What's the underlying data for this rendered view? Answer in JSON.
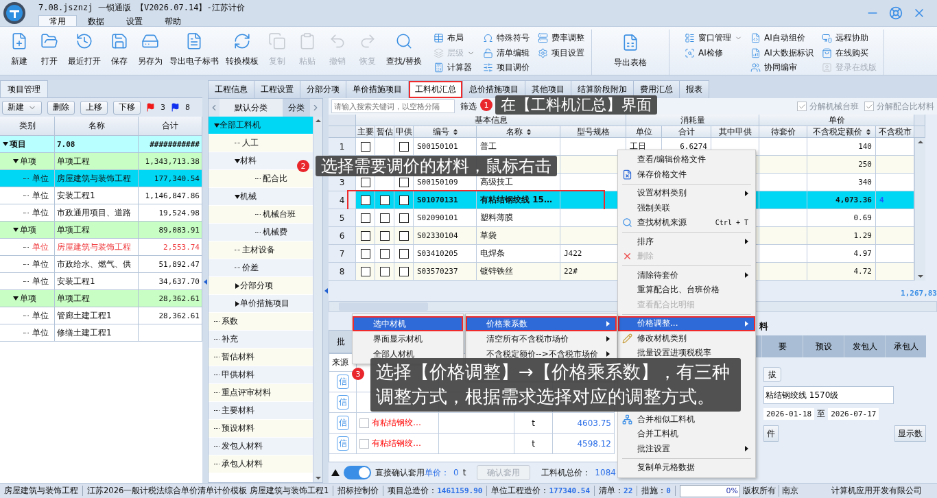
{
  "window": {
    "title": "7.08.jsznzj 一锁通版 【V2026.07.14】-江苏计价"
  },
  "menu_tabs": [
    {
      "label": "常用",
      "selected": true
    },
    {
      "label": "数据",
      "selected": false
    },
    {
      "label": "设置",
      "selected": false
    },
    {
      "label": "帮助",
      "selected": false
    }
  ],
  "ribbon": {
    "sections": [
      {
        "big": [
          {
            "label": "新建",
            "disabled": false
          },
          {
            "label": "打开",
            "disabled": false
          },
          {
            "label": "最近打开",
            "disabled": false
          },
          {
            "label": "保存",
            "disabled": false
          },
          {
            "label": "另存为",
            "disabled": false
          },
          {
            "label": "导出电子标书",
            "disabled": false
          },
          {
            "label": "转换模板",
            "disabled": false
          },
          {
            "label": "复制",
            "disabled": true
          },
          {
            "label": "粘贴",
            "disabled": true
          },
          {
            "label": "撤销",
            "disabled": true
          },
          {
            "label": "恢复",
            "disabled": true
          },
          {
            "label": "查找/替换",
            "disabled": false
          }
        ],
        "columns": [
          [
            {
              "label": "布局",
              "disabled": false,
              "dropdown": false
            },
            {
              "label": "层级",
              "disabled": true,
              "dropdown": true
            },
            {
              "label": "计算器",
              "disabled": false,
              "dropdown": false
            }
          ],
          [
            {
              "label": "特殊符号",
              "disabled": false,
              "dropdown": false
            },
            {
              "label": "清单编辑",
              "disabled": false,
              "dropdown": false
            },
            {
              "label": "项目调价",
              "disabled": false,
              "dropdown": false
            }
          ],
          [
            {
              "label": "费率调整",
              "disabled": false,
              "dropdown": false
            },
            {
              "label": "项目设置",
              "disabled": false,
              "dropdown": false
            }
          ]
        ]
      },
      {
        "big": [
          {
            "label": "导出表格",
            "disabled": false
          }
        ]
      },
      {
        "columns": [
          [
            {
              "label": "窗口管理",
              "disabled": false,
              "dropdown": true
            },
            {
              "label": "AI检修",
              "disabled": false,
              "dropdown": false
            }
          ],
          [
            {
              "label": "AI自动组价",
              "disabled": false,
              "dropdown": false
            },
            {
              "label": "AI大数据标识",
              "disabled": false,
              "dropdown": false
            },
            {
              "label": "协同编审",
              "disabled": false,
              "dropdown": false
            }
          ],
          [
            {
              "label": "远程协助",
              "disabled": false,
              "dropdown": false
            },
            {
              "label": "在线购买",
              "disabled": false,
              "dropdown": false
            },
            {
              "label": "登录在线版",
              "disabled": true,
              "dropdown": false
            }
          ]
        ]
      }
    ]
  },
  "project": {
    "tab": "项目管理",
    "toolbar": [
      {
        "label": "新建",
        "dropdown": true
      },
      {
        "label": "删除",
        "dropdown": false
      },
      {
        "label": "上移",
        "dropdown": false
      },
      {
        "label": "下移",
        "dropdown": false
      }
    ],
    "red_flags": "3",
    "blue_flags": "8",
    "columns": [
      "类别",
      "名称",
      "合计"
    ],
    "tree": [
      {
        "kind": "project",
        "type": "项目",
        "name": "7.08",
        "total": "###########",
        "expanded": true,
        "selected": false,
        "flagged": false,
        "children": [
          {
            "kind": "item",
            "type": "单项",
            "name": "单项工程",
            "total": "1,343,713.38",
            "expanded": true,
            "selected": false,
            "flagged": false,
            "children": [
              {
                "kind": "unit",
                "type": "单位",
                "name": "房屋建筑与装饰工程",
                "total": "177,340.54",
                "selected": true,
                "flagged": false
              },
              {
                "kind": "unit",
                "type": "单位",
                "name": "安装工程1",
                "total": "1,146,847.86",
                "selected": false,
                "flagged": false
              },
              {
                "kind": "unit",
                "type": "单位",
                "name": "市政通用项目、道路",
                "total": "19,524.98",
                "selected": false,
                "flagged": false
              }
            ]
          },
          {
            "kind": "item",
            "type": "单项",
            "name": "单项工程",
            "total": "89,083.91",
            "expanded": true,
            "selected": false,
            "flagged": false,
            "children": [
              {
                "kind": "unit",
                "type": "单位",
                "name": "房屋建筑与装饰工程",
                "total": "2,553.74",
                "selected": false,
                "flagged": true
              },
              {
                "kind": "unit",
                "type": "单位",
                "name": "市政给水、燃气、供",
                "total": "51,892.47",
                "selected": false,
                "flagged": false
              },
              {
                "kind": "unit",
                "type": "单位",
                "name": "安装工程1",
                "total": "34,637.70",
                "selected": false,
                "flagged": false
              }
            ]
          },
          {
            "kind": "item",
            "type": "单项",
            "name": "单项工程",
            "total": "28,362.61",
            "expanded": true,
            "selected": false,
            "flagged": false,
            "children": [
              {
                "kind": "unit",
                "type": "单位",
                "name": "管廊土建工程1",
                "total": "28,362.61",
                "selected": false,
                "flagged": false
              },
              {
                "kind": "unit",
                "type": "单位",
                "name": "修缮土建工程1",
                "selected": false,
                "flagged": false
              }
            ]
          }
        ]
      }
    ]
  },
  "main_tabs": [
    {
      "label": "工程信息",
      "selected": false,
      "framed": false
    },
    {
      "label": "工程设置",
      "selected": false,
      "framed": false
    },
    {
      "label": "分部分项",
      "selected": false,
      "framed": false
    },
    {
      "label": "单价措施项目",
      "selected": false,
      "framed": false
    },
    {
      "label": "工料机汇总",
      "selected": true,
      "framed": true
    },
    {
      "label": "总价措施项目",
      "selected": false,
      "framed": false
    },
    {
      "label": "其他项目",
      "selected": false,
      "framed": false
    },
    {
      "label": "结算阶段附加",
      "selected": false,
      "framed": false
    },
    {
      "label": "费用汇总",
      "selected": false,
      "framed": false
    },
    {
      "label": "报表",
      "selected": false,
      "framed": false
    }
  ],
  "categories": {
    "tabs": [
      {
        "label": "默认分类",
        "selected": true
      },
      {
        "label": "分类",
        "selected": false
      }
    ],
    "tree": [
      {
        "name": "全部工料机",
        "expanded": true,
        "selected": true,
        "children": [
          {
            "name": "人工",
            "selected": false
          },
          {
            "name": "材料",
            "expanded": true,
            "selected": false,
            "children": [
              {
                "name": "配合比",
                "selected": false
              }
            ]
          },
          {
            "name": "机械",
            "expanded": true,
            "selected": false,
            "children": [
              {
                "name": "机械台班",
                "selected": false
              },
              {
                "name": "机械费",
                "selected": false
              }
            ]
          },
          {
            "name": "主材设备",
            "selected": false
          },
          {
            "name": "价差",
            "selected": false
          },
          {
            "name": "分部分项",
            "expanded": false,
            "selected": false
          },
          {
            "name": "单价措施项目",
            "expanded": false,
            "selected": false
          }
        ]
      },
      {
        "name": "系数",
        "selected": false
      },
      {
        "name": "补充",
        "selected": false
      },
      {
        "name": "暂估材料",
        "selected": false
      },
      {
        "name": "甲供材料",
        "selected": false
      },
      {
        "name": "重点评审材料",
        "selected": false
      },
      {
        "name": "主要材料",
        "selected": false
      },
      {
        "name": "预设材料",
        "selected": false
      },
      {
        "name": "发包人材料",
        "selected": false
      },
      {
        "name": "承包人材料",
        "selected": false
      }
    ]
  },
  "grid": {
    "search": {
      "placeholder": "请输入搜索关键词，以空格分隔"
    },
    "filter": "筛选",
    "options": [
      {
        "label": "分解机械台班",
        "checked": true
      },
      {
        "label": "分解配合比材料",
        "checked": true
      }
    ],
    "groups": [
      "基本信息",
      "消耗量",
      "单价"
    ],
    "columns": [
      {
        "label": "主要",
        "sortable": false
      },
      {
        "label": "暂估",
        "sortable": false
      },
      {
        "label": "甲供",
        "sortable": false
      },
      {
        "label": "编号",
        "sortable": true
      },
      {
        "label": "名称",
        "sortable": true
      },
      {
        "label": "型号规格",
        "sortable": false
      },
      {
        "label": "单位",
        "sortable": false
      },
      {
        "label": "合计",
        "sortable": false
      },
      {
        "label": "其中甲供",
        "sortable": false
      },
      {
        "label": "待套价",
        "sortable": false
      },
      {
        "label": "不含税定额价",
        "sortable": true
      },
      {
        "label": "不含税市",
        "sortable": false
      }
    ],
    "rows": [
      {
        "no": "1",
        "main": false,
        "supply": false,
        "code": "S00150101",
        "name": "普工",
        "unit": "工日",
        "total": "6.6274",
        "price": "140",
        "selected": false,
        "framed": false
      },
      {
        "price": "250",
        "selected": false,
        "framed": false
      },
      {
        "no": "3",
        "main": false,
        "supply": false,
        "code": "S00150109",
        "name": "高级技工",
        "price": "340",
        "selected": false,
        "framed": false
      },
      {
        "no": "4",
        "main": false,
        "est": false,
        "supply": false,
        "code": "S01070131",
        "name": "有粘结钢绞线 15…",
        "price": "4,073.36",
        "price2": "4",
        "selected": true,
        "framed": true
      },
      {
        "no": "5",
        "main": false,
        "est": false,
        "supply": false,
        "code": "S02090101",
        "name": "塑料薄膜",
        "price": "0.69",
        "selected": false,
        "framed": false
      },
      {
        "no": "6",
        "main": false,
        "est": false,
        "supply": false,
        "code": "S02330104",
        "name": "草袋",
        "price": "1.29",
        "selected": false,
        "framed": false
      },
      {
        "no": "7",
        "main": false,
        "est": false,
        "supply": false,
        "code": "S03410205",
        "name": "电焊条",
        "spec": "J422",
        "price": "4.97",
        "selected": false,
        "framed": false
      },
      {
        "no": "8",
        "main": false,
        "est": false,
        "supply": false,
        "code": "S03570237",
        "name": "镀锌铁丝",
        "spec": "22#",
        "price": "4.72",
        "selected": false,
        "framed": false
      }
    ],
    "total": "1,267,83"
  },
  "lower": {
    "tab": "批",
    "source_header": "来源",
    "rows": [
      {
        "source": "信"
      },
      {
        "source": "信"
      },
      {
        "source": "信",
        "checked": false,
        "name": "有粘结钢绞…",
        "unit": "t",
        "price": "4603.75"
      },
      {
        "source": "信",
        "checked": false,
        "name": "有粘结钢绞…",
        "unit": "t",
        "price": "4598.12"
      }
    ],
    "side": {
      "title": "料",
      "tabs": [
        "要",
        "预设",
        "发包人",
        "承包人"
      ],
      "button": "拔",
      "field": "粘结钢绞线 1570级",
      "date_from": "2026-01-18",
      "date_sep": "至",
      "date_to": "2026-07-17",
      "columns": [
        "件",
        "显示数"
      ]
    }
  },
  "bottom_bar": {
    "toggle_on": true,
    "label": "直接确认套用",
    "price_label": "单价：",
    "qty": "0",
    "unit": "t",
    "confirm": {
      "label": "确认套用",
      "disabled": true
    },
    "total_label": "工料机总价：",
    "total": "1084"
  },
  "status": [
    {
      "label": "房屋建筑与装饰工程"
    },
    {
      "label": "江苏2026一般计税法综合单价清单计价模板 房屋建筑与装饰工程1"
    },
    {
      "label": "招标控制价"
    },
    {
      "label": "项目总造价：",
      "value": "1461159.90"
    },
    {
      "label": "单位工程造价：",
      "value": "177340.54"
    },
    {
      "label": "清单：",
      "value": "22"
    },
    {
      "label": "措施：",
      "value": "0"
    }
  ],
  "progress": {
    "label": "0%",
    "level": 0
  },
  "copyright": "版权所有",
  "company": [
    "南京",
    "计算机应用开发有限公司"
  ],
  "context_menu": [
    {
      "kind": "item",
      "label": "查看/编辑价格文件",
      "submenu": false,
      "disabled": false,
      "highlighted": false,
      "framed": false
    },
    {
      "kind": "item",
      "label": "保存价格文件",
      "submenu": false,
      "disabled": false,
      "highlighted": false,
      "framed": false
    },
    {
      "kind": "separator"
    },
    {
      "kind": "item",
      "label": "设置材料类别",
      "submenu": true,
      "disabled": false,
      "highlighted": false,
      "framed": false
    },
    {
      "kind": "item",
      "label": "强制关联",
      "submenu": false,
      "disabled": false,
      "highlighted": false,
      "framed": false
    },
    {
      "kind": "item",
      "label": "查找材机来源",
      "shortcut": "Ctrl + T",
      "submenu": false,
      "disabled": false,
      "highlighted": false,
      "framed": false
    },
    {
      "kind": "separator"
    },
    {
      "kind": "item",
      "label": "排序",
      "submenu": true,
      "disabled": false,
      "highlighted": false,
      "framed": false
    },
    {
      "kind": "item",
      "label": "删除",
      "submenu": false,
      "disabled": true,
      "highlighted": false,
      "framed": false
    },
    {
      "kind": "separator"
    },
    {
      "kind": "item",
      "label": "清除待套价",
      "submenu": true,
      "disabled": false,
      "highlighted": false,
      "framed": false
    },
    {
      "kind": "item",
      "label": "重算配合比、台班价格",
      "submenu": false,
      "disabled": false,
      "highlighted": false,
      "framed": false
    },
    {
      "kind": "item",
      "label": "查看配合比明细",
      "submenu": false,
      "disabled": true,
      "highlighted": false,
      "framed": false
    },
    {
      "kind": "separator"
    },
    {
      "kind": "item",
      "label": "价格调整...",
      "submenu": true,
      "disabled": false,
      "highlighted": true,
      "framed": true
    },
    {
      "kind": "item",
      "label": "修改材机类别",
      "submenu": false,
      "disabled": false,
      "highlighted": false,
      "framed": false
    },
    {
      "kind": "item",
      "label": "批量设置进项税税率",
      "submenu": false,
      "disabled": false,
      "highlighted": false,
      "framed": false
    },
    {
      "kind": "covered"
    },
    {
      "kind": "covered"
    },
    {
      "kind": "covered"
    },
    {
      "kind": "item",
      "label": "合并相似工料机",
      "submenu": false,
      "disabled": false,
      "highlighted": false,
      "framed": false
    },
    {
      "kind": "item",
      "label": "合并工料机",
      "submenu": false,
      "disabled": false,
      "highlighted": false,
      "framed": false
    },
    {
      "kind": "item",
      "label": "批注设置",
      "submenu": true,
      "disabled": false,
      "highlighted": false,
      "framed": false
    },
    {
      "kind": "separator"
    },
    {
      "kind": "item",
      "label": "复制单元格数据",
      "submenu": false,
      "disabled": false,
      "highlighted": false,
      "framed": false
    }
  ],
  "price_menu": [
    {
      "kind": "item",
      "label": "价格乘系数",
      "submenu": true,
      "highlighted": true,
      "framed": true
    },
    {
      "kind": "item",
      "label": "清空所有不含税市场价",
      "submenu": true,
      "highlighted": false,
      "framed": false
    },
    {
      "kind": "item",
      "label": "不含税定额价-->不含税市场价",
      "submenu": true,
      "highlighted": false,
      "framed": false
    },
    {
      "kind": "covered"
    }
  ],
  "scope_menu": [
    {
      "kind": "item",
      "label": "选中材机",
      "highlighted": true,
      "framed": true
    },
    {
      "kind": "item",
      "label": "界面显示材机",
      "highlighted": false,
      "framed": false
    },
    {
      "kind": "item",
      "label": "全部人材机",
      "highlighted": false,
      "framed": false
    }
  ],
  "callouts": [
    {
      "number": "1",
      "text": "在【工料机汇总】界面"
    },
    {
      "number": "2",
      "text": "选择需要调价的材料，鼠标右击"
    },
    {
      "number": "3",
      "text": "选择【价格调整】→【价格乘系数】，有三种调整方式，根据需求选择对应的调整方式。"
    }
  ]
}
